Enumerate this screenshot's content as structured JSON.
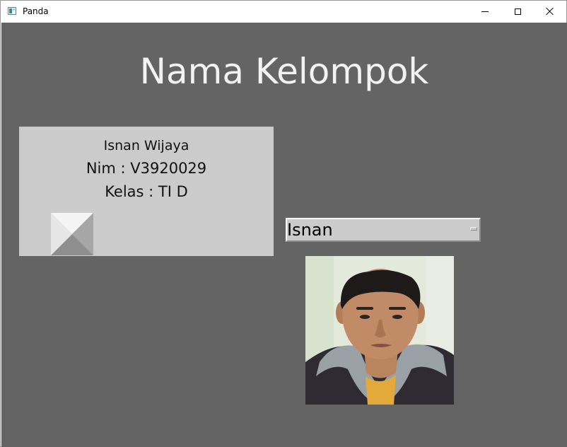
{
  "window": {
    "title": "Panda",
    "icon": "panda-app-icon"
  },
  "main": {
    "heading": "Nama Kelompok",
    "card": {
      "name": "Isnan Wijaya",
      "nim": "Nim : V3920029",
      "kelas": "Kelas : TI D",
      "image_icon": "broken-image-placeholder"
    },
    "member_select": {
      "selected": "Isnan"
    },
    "photo": {
      "icon": "member-photo"
    }
  },
  "colors": {
    "background": "#646464",
    "card": "#cbcbcb",
    "heading": "#f2f2f2",
    "dropdown": "#cbcbcb"
  }
}
